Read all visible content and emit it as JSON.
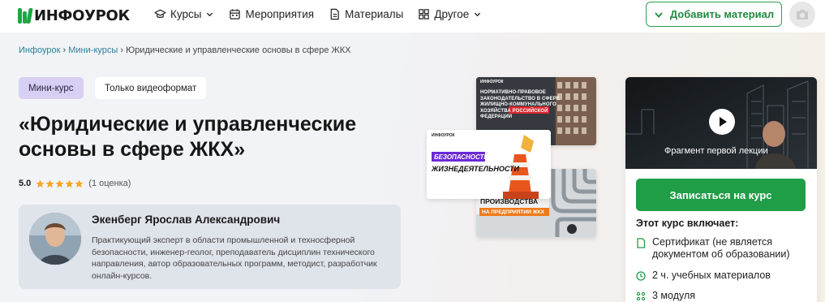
{
  "header": {
    "logo_text": "ИНФОУРОК",
    "nav": [
      {
        "label": "Курсы",
        "icon": "graduation-cap-icon",
        "has_dropdown": true
      },
      {
        "label": "Мероприятия",
        "icon": "calendar-icon",
        "has_dropdown": false
      },
      {
        "label": "Материалы",
        "icon": "document-icon",
        "has_dropdown": false
      },
      {
        "label": "Другое",
        "icon": "grid-icon",
        "has_dropdown": true
      }
    ],
    "add_material_label": "Добавить материал"
  },
  "breadcrumb": {
    "items": [
      "Инфоурок",
      "Мини-курсы",
      "Юридические и управленческие основы в сфере ЖКХ"
    ],
    "separator": "›"
  },
  "tags": {
    "mini": "Мини-курс",
    "video": "Только видеоформат"
  },
  "course": {
    "title": "«Юридические и управленческие основы в сфере ЖКХ»",
    "rating_value": "5.0",
    "stars": 5,
    "rating_count": "(1 оценка)"
  },
  "author": {
    "name": "Экенберг Ярослав Александрович",
    "bio": "Практикующий эксперт в области промышленной и техносферной безопасности, инженер-геолог, преподаватель дисциплин технического направления, автор образовательных программ, методист, разработчик онлайн-курсов."
  },
  "collage": {
    "thumb1_brand": "ИНФОУРОК",
    "thumb1_lines": [
      "НОРМАТИВНО-ПРАВОВОЕ",
      "ЗАКОНОДАТЕЛЬСТВО В СФЕРЕ",
      "ЖИЛИЩНО-КОММУНАЛЬНОГО",
      "ХОЗЯЙСТВА РОССИЙСКОЙ",
      "ФЕДЕРАЦИИ"
    ],
    "thumb2_brand": "ИНФОУРОК",
    "thumb2_tag": "БЕЗОПАСНОСТЬ",
    "thumb2_text": "ЖИЗНЕДЕЯТЕЛЬНОСТИ",
    "thumb3_text": "ПРОИЗВОДСТВА",
    "thumb3_tag": "НА ПРЕДПРИЯТИИ ЖКХ"
  },
  "card": {
    "video_caption": "Фрагмент первой лекции",
    "enroll_label": "Записаться на курс",
    "includes_title": "Этот курс включает:",
    "includes": [
      {
        "icon": "certificate-icon",
        "text": "Сертификат (не является документом об образовании)"
      },
      {
        "icon": "clock-icon",
        "text": "2 ч. учебных материалов"
      },
      {
        "icon": "modules-icon",
        "text": "3 модуля"
      }
    ]
  },
  "colors": {
    "brand_green": "#1f9d47",
    "mini_tag_bg": "#d8d0f2",
    "star": "#f5a623",
    "link": "#2a7f9a"
  }
}
